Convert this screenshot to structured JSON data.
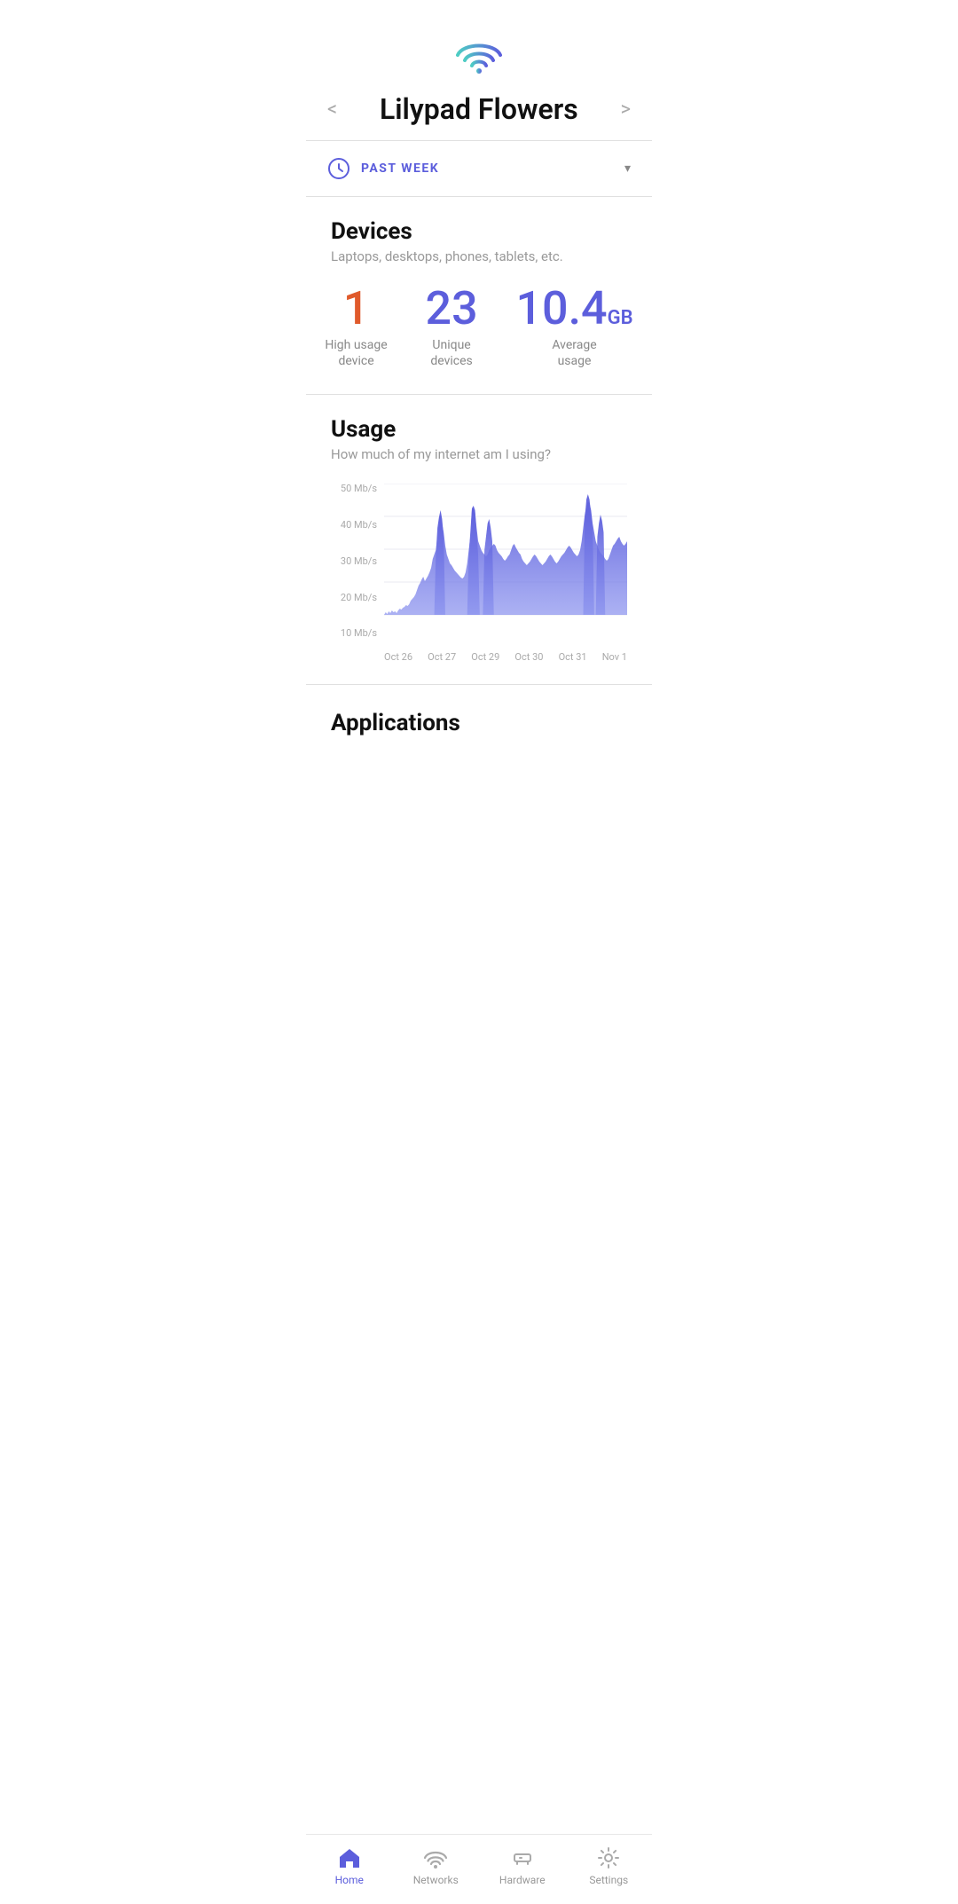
{
  "header": {
    "wifi_alt": "WiFi signal icon",
    "network_name": "Lilypad Flowers",
    "prev_arrow": "<",
    "next_arrow": ">"
  },
  "period": {
    "icon_alt": "clock icon",
    "label": "PAST WEEK",
    "dropdown_symbol": "▾"
  },
  "devices": {
    "title": "Devices",
    "subtitle": "Laptops, desktops, phones, tablets, etc.",
    "stats": [
      {
        "value": "1",
        "unit": "",
        "color": "red",
        "label": "High usage\ndevice"
      },
      {
        "value": "23",
        "unit": "",
        "color": "purple",
        "label": "Unique\ndevices"
      },
      {
        "value": "10.4",
        "unit": "GB",
        "color": "blue",
        "label": "Average\nusage"
      }
    ]
  },
  "usage": {
    "title": "Usage",
    "subtitle": "How much of my internet am I using?",
    "y_labels": [
      "10 Mb/s",
      "20 Mb/s",
      "30 Mb/s",
      "40 Mb/s",
      "50 Mb/s"
    ],
    "x_labels": [
      "Oct 26",
      "Oct 27",
      "Oct 29",
      "Oct 30",
      "Oct 31",
      "Nov 1"
    ]
  },
  "applications": {
    "title": "Applications"
  },
  "bottom_nav": [
    {
      "id": "home",
      "label": "Home",
      "active": true
    },
    {
      "id": "networks",
      "label": "Networks",
      "active": false
    },
    {
      "id": "hardware",
      "label": "Hardware",
      "active": false
    },
    {
      "id": "settings",
      "label": "Settings",
      "active": false
    }
  ]
}
